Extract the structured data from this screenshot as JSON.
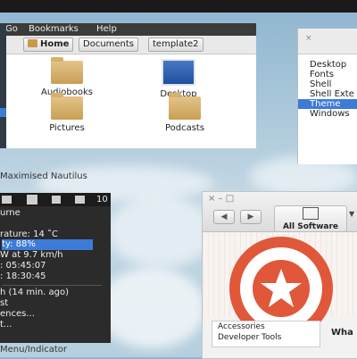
{
  "nautilus": {
    "menu": [
      "Go",
      "Bookmarks",
      "Help"
    ],
    "breadcrumbs": [
      "Home",
      "Documents",
      "template2"
    ],
    "items": [
      "Audiobooks",
      "Desktop",
      "Pictures",
      "Podcasts"
    ],
    "caption": "Maximised Nautilus"
  },
  "prefs": {
    "close": "×",
    "items": [
      "Desktop",
      "Fonts",
      "Shell",
      "Shell Exte",
      "Theme",
      "Windows"
    ],
    "selected_index": 4
  },
  "indicator": {
    "clock": "10",
    "rows": [
      "urne",
      "rature: 14 ˚C",
      "ty: 88%",
      "W at 9.7 km/h",
      ": 05:45:07",
      ": 18:30:45",
      "h (14 min. ago)",
      "st",
      "ences...",
      "t..."
    ],
    "highlighted_index": 2,
    "caption": "Menu/Indicator"
  },
  "software": {
    "window_controls": "× – □",
    "back": "◀",
    "forward": "▶",
    "all_label": "All Software",
    "categories": [
      "Accessories",
      "Developer Tools"
    ],
    "side_heading": "Wha",
    "accent": "#e0573a"
  }
}
